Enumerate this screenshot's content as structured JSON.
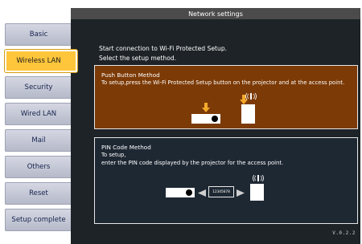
{
  "window": {
    "title": "Network settings"
  },
  "sidebar": {
    "items": [
      {
        "label": "Basic",
        "selected": false
      },
      {
        "label": "Wireless LAN",
        "selected": true
      },
      {
        "label": "Security",
        "selected": false
      },
      {
        "label": "Wired LAN",
        "selected": false
      },
      {
        "label": "Mail",
        "selected": false
      },
      {
        "label": "Others",
        "selected": false
      },
      {
        "label": "Reset",
        "selected": false
      },
      {
        "label": "Setup complete",
        "selected": false
      }
    ]
  },
  "main": {
    "instruction_line1": "Start connection to Wi-Fi Protected Setup.",
    "instruction_line2": "Select the setup method.",
    "push_button": {
      "title": "Push Button Method",
      "text": "To setup,press the Wi-Fi Protected Setup button on the projector and at the access point."
    },
    "pin_code": {
      "title": "PIN Code Method",
      "line1": "To setup,",
      "line2": "enter the PIN code displayed by the projector for the access point.",
      "pin": "12345678"
    },
    "version": "V.0.2.2"
  },
  "colors": {
    "selected_tab": "#ffc63c",
    "push_box_bg": "#7c3a06",
    "arrow": "#f2a92a",
    "main_bg": "#1d2327"
  },
  "icons": [
    "projector-icon",
    "access-point-icon",
    "wifi-signal-icon",
    "arrow-down-icon",
    "arrow-left-icon",
    "arrow-right-icon"
  ]
}
